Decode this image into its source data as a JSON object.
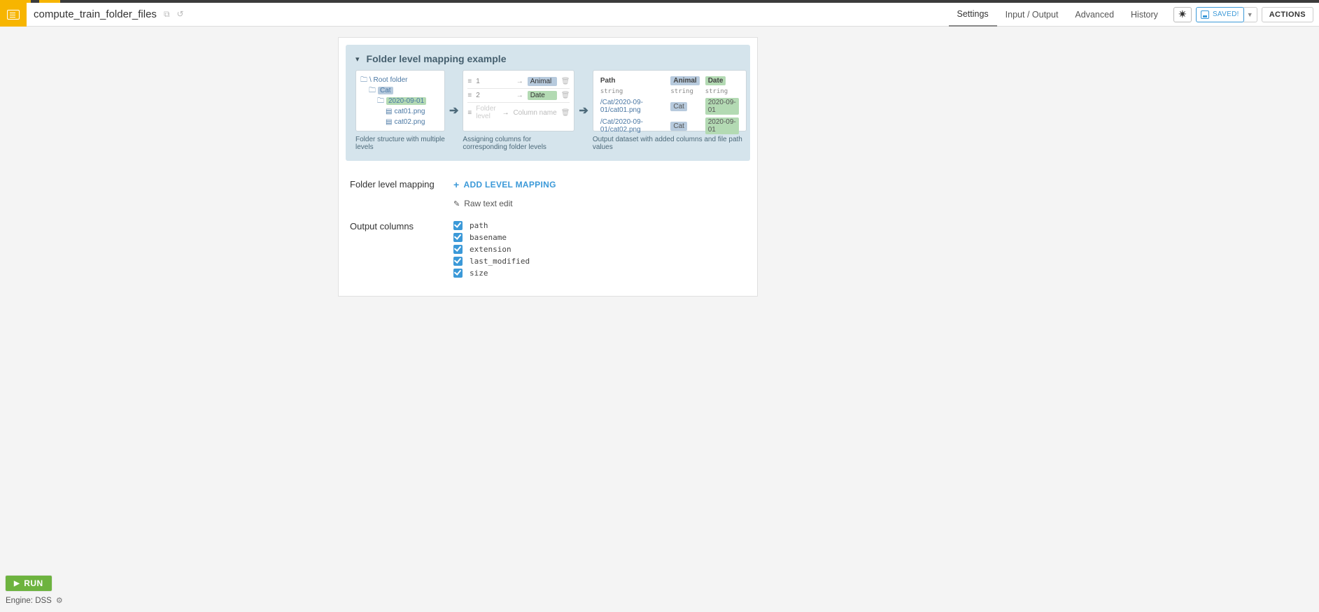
{
  "header": {
    "title": "compute_train_folder_files",
    "tabs": {
      "settings": "Settings",
      "io": "Input / Output",
      "advanced": "Advanced",
      "history": "History"
    },
    "saved_label": "SAVED!",
    "actions_label": "ACTIONS"
  },
  "example": {
    "title": "Folder level mapping example",
    "box1": {
      "root": "\\ Root folder",
      "cat": "Cat",
      "date": "2020-09-01",
      "file1": "cat01.png",
      "file2": "cat02.png",
      "caption": "Folder structure with multiple levels"
    },
    "box2": {
      "row1_level": "1",
      "row2_level": "2",
      "row3_level_placeholder": "Folder level",
      "row1_col": "Animal",
      "row2_col": "Date",
      "row3_col_placeholder": "Column name",
      "caption": "Assigning columns for corresponding folder levels"
    },
    "box3": {
      "col_path": "Path",
      "col_animal": "Animal",
      "col_date": "Date",
      "type": "string",
      "row1_path": "/Cat/2020-09-01/cat01.png",
      "row2_path": "/Cat/2020-09-01/cat02.png",
      "cell_animal": "Cat",
      "cell_date": "2020-09-01",
      "caption": "Output dataset with added columns and file path values"
    }
  },
  "form": {
    "mapping_label": "Folder level mapping",
    "add_mapping": "ADD LEVEL MAPPING",
    "raw_text_edit": "Raw text edit",
    "output_columns_label": "Output columns",
    "columns": {
      "path": "path",
      "basename": "basename",
      "extension": "extension",
      "last_modified": "last_modified",
      "size": "size"
    }
  },
  "footer": {
    "run_label": "RUN",
    "engine": "Engine: DSS"
  }
}
